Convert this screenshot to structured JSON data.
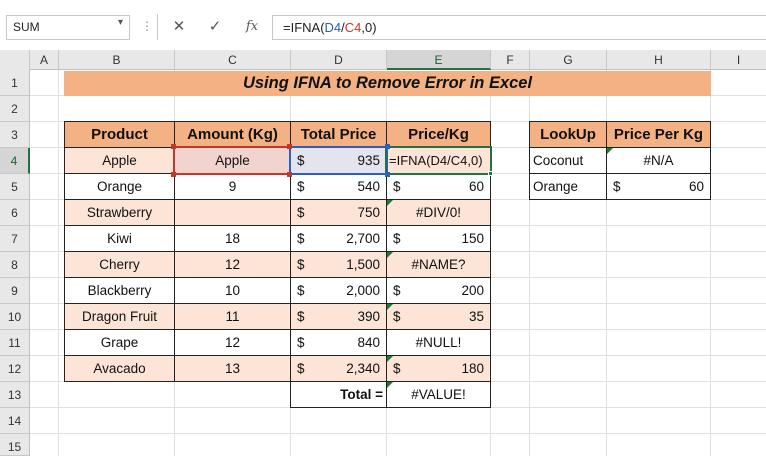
{
  "formula_bar": {
    "name_box": "SUM",
    "name_box_dropdown_glyph": "▾",
    "cancel_glyph": "✕",
    "enter_glyph": "✓",
    "function_glyph": "fx",
    "formula_prefix": "=IFNA(",
    "formula_ref1": "D4",
    "formula_slash": "/",
    "formula_ref2": "C4",
    "formula_suffix": ",0)"
  },
  "columns": [
    "A",
    "B",
    "C",
    "D",
    "E",
    "F",
    "G",
    "H",
    "I"
  ],
  "rows": [
    "1",
    "2",
    "3",
    "4",
    "5",
    "6",
    "7",
    "8",
    "9",
    "10",
    "11",
    "12",
    "13",
    "14",
    "15"
  ],
  "title": "Using IFNA to Remove Error in Excel",
  "main_table": {
    "headers": [
      "Product",
      "Amount (Kg)",
      "Total Price",
      "Price/Kg"
    ],
    "currency": "$",
    "rows": [
      {
        "product": "Apple",
        "amount": "Apple",
        "total": "935",
        "price": "=IFNA(D4/C4,0)"
      },
      {
        "product": "Orange",
        "amount": "9",
        "total": "540",
        "price": "60"
      },
      {
        "product": "Strawberry",
        "amount": "",
        "total": "750",
        "price": "#DIV/0!"
      },
      {
        "product": "Kiwi",
        "amount": "18",
        "total": "2,700",
        "price": "150"
      },
      {
        "product": "Cherry",
        "amount": "12",
        "total": "1,500",
        "price": "#NAME?"
      },
      {
        "product": "Blackberry",
        "amount": "10",
        "total": "2,000",
        "price": "200"
      },
      {
        "product": "Dragon Fruit",
        "amount": "11",
        "total": "390",
        "price": "35"
      },
      {
        "product": "Grape",
        "amount": "12",
        "total": "840",
        "price": "#NULL!"
      },
      {
        "product": "Avacado",
        "amount": "13",
        "total": "2,340",
        "price": "180"
      }
    ],
    "total_label": "Total =",
    "total_value": "#VALUE!"
  },
  "lookup_table": {
    "headers": [
      "LookUp",
      "Price Per Kg"
    ],
    "rows": [
      {
        "item": "Coconut",
        "price": "#N/A"
      },
      {
        "item": "Orange",
        "price": "60"
      }
    ]
  },
  "colors": {
    "header_fill": "#f4b183",
    "row_fill": "#fce4d6",
    "selection_green": "#217346",
    "ref_blue": "#2d5fbd",
    "ref_red": "#c0392b"
  }
}
